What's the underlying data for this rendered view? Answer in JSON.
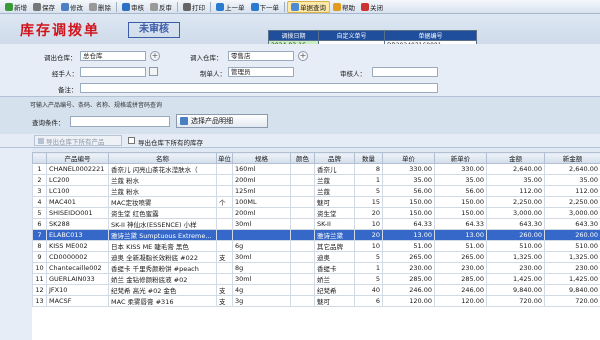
{
  "toolbar": [
    {
      "name": "new-button",
      "label": "新增",
      "icon": "#3a9a3a",
      "active": false
    },
    {
      "name": "save-button",
      "label": "保存",
      "icon": "#777777",
      "active": false
    },
    {
      "name": "edit-button",
      "label": "修改",
      "icon": "#4a7fc1",
      "active": false
    },
    {
      "name": "delete-button",
      "label": "删除",
      "icon": "#999999",
      "active": false
    },
    {
      "name": "review-button",
      "label": "审核",
      "icon": "#2d6fc4",
      "active": false
    },
    {
      "name": "unreview-button",
      "label": "反审",
      "icon": "#999999",
      "active": false
    },
    {
      "name": "print-button",
      "label": "打印",
      "icon": "#666666",
      "active": false
    },
    {
      "name": "prev-button",
      "label": "上一单",
      "icon": "#2a7ad0",
      "active": false
    },
    {
      "name": "next-button",
      "label": "下一单",
      "icon": "#2a7ad0",
      "active": false
    },
    {
      "name": "query-button",
      "label": "单据查询",
      "icon": "#4c8ad4",
      "active": true
    },
    {
      "name": "help-button",
      "label": "帮助",
      "icon": "#e39b1e",
      "active": false
    },
    {
      "name": "close-button",
      "label": "关闭",
      "icon": "#cc3333",
      "active": false
    }
  ],
  "page_title": "库存调拨单",
  "status_stamp": "未审核",
  "header_table": {
    "col1": "调拨日期",
    "col2": "自定义单号",
    "col3": "单据编号",
    "date": "2024-03-16",
    "custom_no": "",
    "doc_no": "DB202403160001"
  },
  "form": {
    "out_wh_label": "调出仓库：",
    "out_wh": "总仓库",
    "in_wh_label": "调入仓库：",
    "in_wh": "零售店",
    "handler_label": "经手人：",
    "handler": "",
    "maker_label": "制单人：",
    "maker": "管理员",
    "reviewer_label": "审核人：",
    "reviewer": "",
    "remark_label": "备注：",
    "remark": ""
  },
  "query": {
    "hint": "可输入产品编号、条码、名称、规格或拼音码查询",
    "label": "查询条件：",
    "value": "",
    "select_label": "选择产品明细"
  },
  "opts": {
    "export_label": "导出仓库下所有产品",
    "export_checkbox_label": "导出仓库下所有的库存"
  },
  "grid": {
    "columns": [
      "",
      "产品编号",
      "名称",
      "单位",
      "规格",
      "颜色",
      "品牌",
      "数量",
      "单价",
      "新单价",
      "金额",
      "新金额"
    ],
    "rows": [
      [
        "1",
        "CHANEL0002221",
        "香奈儿 闪亮山茶花水滢肤水（",
        "",
        "160ml",
        "",
        "香奈儿",
        "8",
        "330.00",
        "330.00",
        "2,640.00",
        "2,640.00"
      ],
      [
        "2",
        "LC200",
        "兰蔻 粉水",
        "",
        "200ml",
        "",
        "兰蔻",
        "1",
        "35.00",
        "35.00",
        "35.00",
        "35.00"
      ],
      [
        "3",
        "LC100",
        "兰蔻 粉水",
        "",
        "125ml",
        "",
        "兰蔻",
        "5",
        "56.00",
        "56.00",
        "112.00",
        "112.00"
      ],
      [
        "4",
        "MAC401",
        "MAC定妆喷雾",
        "个",
        "100ML",
        "",
        "魅可",
        "15",
        "150.00",
        "150.00",
        "2,250.00",
        "2,250.00"
      ],
      [
        "5",
        "SHISEIDO001",
        "资生堂 红色蜜露",
        "",
        "200ml",
        "",
        "资生堂",
        "20",
        "150.00",
        "150.00",
        "3,000.00",
        "3,000.00"
      ],
      [
        "6",
        "SK288",
        "SK-II 神仙水(ESSENCE) 小样",
        "",
        "30ml",
        "",
        "SK-II",
        "10",
        "64.33",
        "64.33",
        "643.30",
        "643.30"
      ],
      [
        "7",
        "ELABC013",
        "雅诗兰黛 Sumptuous Extreme...",
        "",
        "",
        "",
        "雅诗兰黛",
        "20",
        "13.00",
        "13.00",
        "260.00",
        "260.00"
      ],
      [
        "8",
        "KISS ME002",
        "日本 KISS ME 睫毛膏 黑色",
        "",
        "6g",
        "",
        "其它品牌",
        "10",
        "51.00",
        "51.00",
        "510.00",
        "510.00"
      ],
      [
        "9",
        "CD0000002",
        "迪奥 全新凝脂长效粉底 #022",
        "支",
        "30ml",
        "",
        "迪奥",
        "5",
        "265.00",
        "265.00",
        "1,325.00",
        "1,325.00"
      ],
      [
        "10",
        "Chantecaille002",
        "香缇卡 千里秀颜粉饼 #peach",
        "",
        "8g",
        "",
        "香缇卡",
        "1",
        "230.00",
        "230.00",
        "230.00",
        "230.00"
      ],
      [
        "11",
        "GUERLAIN033",
        "娇兰 金钻修颜粉底液 #02",
        "",
        "30ml",
        "",
        "娇兰",
        "5",
        "285.00",
        "285.00",
        "1,425.00",
        "1,425.00"
      ],
      [
        "12",
        "JFX10",
        "纪梵希 高光 #02 金色",
        "支",
        "4g",
        "",
        "纪梵希",
        "40",
        "246.00",
        "246.00",
        "9,840.00",
        "9,840.00"
      ],
      [
        "13",
        "MACSF",
        "MAC 柔雾唇膏 #316",
        "支",
        "3g",
        "",
        "魅可",
        "6",
        "120.00",
        "120.00",
        "720.00",
        "720.00"
      ]
    ]
  },
  "colors": {
    "accent": "#1f4e9c",
    "title": "#d1141d",
    "selection": "#3568c8"
  }
}
